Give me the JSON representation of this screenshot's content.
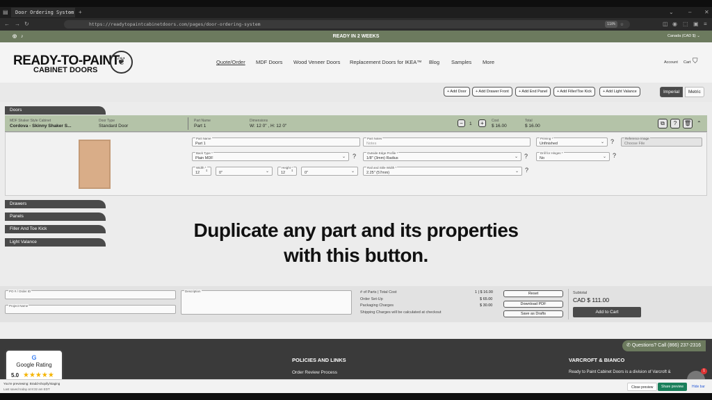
{
  "browser": {
    "tab_title": "Door Ordering System",
    "url": "https://readytopaintcabinetdoors.com/pages/door-ordering-system",
    "zoom": "110%"
  },
  "announcement": {
    "text": "READY IN 2 WEEKS",
    "region": "Canada (CAD $)"
  },
  "header": {
    "logo_line1": "READY-TO-PAINT",
    "logo_line2": "CABINET DOORS",
    "nav": [
      "Quote/Order",
      "MDF Doors",
      "Wood Veneer Doors",
      "Replacement Doors for IKEA™",
      "Blog",
      "Samples",
      "More"
    ],
    "account": "Account",
    "cart": "Cart"
  },
  "toolbar": {
    "buttons": [
      "+ Add Door",
      "+ Add Drawer Front",
      "+ Add End Panel",
      "+ Add Filler/Toe Kick",
      "+ Add Light Valance"
    ],
    "units": [
      "Imperial",
      "Metric"
    ]
  },
  "sections": {
    "doors": "Doors",
    "drawers": "Drawers",
    "panels": "Panels",
    "filler": "Filler And Toe Kick",
    "valance": "Light Valance"
  },
  "door_row": {
    "cabinet_label": "MDF Shaker Style Cabinet",
    "cabinet_value": "Cordova - Skinny Shaker S...",
    "type_label": "Door Type",
    "type_value": "Standard Door",
    "name_label": "Part Name",
    "name_value": "Part 1",
    "dim_label": "Dimensions",
    "dim_value": "W: 12 0\"  ,  H: 12 0\"",
    "qty": "1",
    "cost_label": "Cost",
    "cost_value": "$ 16.00",
    "total_label": "Total",
    "total_value": "$ 16.00"
  },
  "fields": {
    "part_name_l": "Part Name",
    "part_name_v": "Part 1",
    "notes_l": "Part Notes",
    "notes_v": "Notes",
    "priming_l": "Priming *",
    "priming_v": "Unfinished",
    "ref_l": "Reference Image",
    "ref_v": "Choose File",
    "back_l": "Back Type *",
    "back_v": "Plain MDF",
    "edge_l": "Outside Edge Profile *",
    "edge_v": "1/8\" (3mm) Radius",
    "drill_l": "Drill for Hinges *",
    "drill_v": "No",
    "width_l": "Width *",
    "width_v": "12",
    "width_frac": "0\"",
    "height_l": "Height *",
    "height_v": "12",
    "height_frac": "0\"",
    "rail_l": "Rail and Stile Width *",
    "rail_v": "2.25\" (57mm)"
  },
  "caption": {
    "line1": "Duplicate any part and its properties",
    "line2": "with this button."
  },
  "order": {
    "po_l": "PO # / Order ID",
    "project_l": "Project Name",
    "desc_l": "Description",
    "parts_l": "# of Parts | Total Cost",
    "parts_v": "1 | $ 16.00",
    "setup_l": "Order Set-Up",
    "setup_v": "$ 65.00",
    "pack_l": "Packaging Charges",
    "pack_v": "$ 30.00",
    "ship_l": "Shipping Charges will be calculated at checkout",
    "reset": "Reset",
    "pdf": "Download PDF",
    "drafts": "Save as Drafts",
    "subtotal_l": "Subtotal",
    "subtotal_v": "CAD $ 111.00",
    "add_cart": "Add to Cart"
  },
  "footer": {
    "policies": "POLICIES AND LINKS",
    "review": "Order Review Process",
    "brand": "VARCROFT & BIANCO",
    "brand_text": "Ready to Paint Cabinet Doors is a division of Varcroft &",
    "questions": "Questions? Call (866) 237-2316",
    "google": "Google Rating",
    "rating": "5.0",
    "badge": "1"
  },
  "preview_bar": {
    "line1": "You're previewing: Bradd-shopify/staging",
    "line2": "Last saved today at 8:32 am EDT",
    "close": "Close preview",
    "share": "Share preview",
    "hide": "Hide bar"
  }
}
